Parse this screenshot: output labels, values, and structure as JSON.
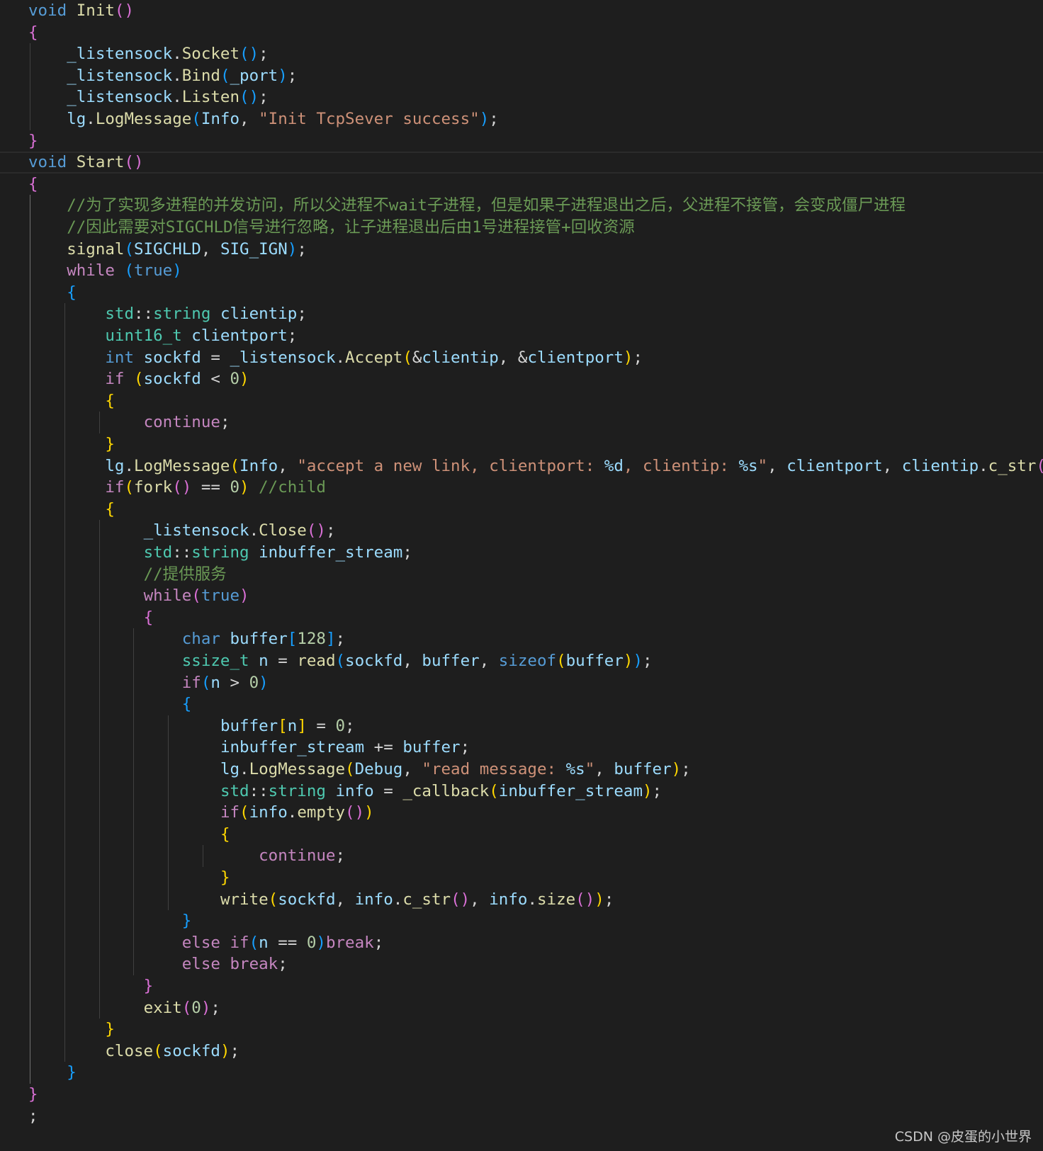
{
  "editor": {
    "lines": [
      [
        [
          "kw",
          "void"
        ],
        [
          "plain",
          " "
        ],
        [
          "fn",
          "Init"
        ],
        [
          "b2",
          "()"
        ]
      ],
      [
        [
          "b2",
          "{"
        ]
      ],
      [
        [
          "plain",
          "    "
        ],
        [
          "var",
          "_listensock"
        ],
        [
          "plain",
          "."
        ],
        [
          "fn",
          "Socket"
        ],
        [
          "b3",
          "()"
        ],
        [
          "plain",
          ";"
        ]
      ],
      [
        [
          "plain",
          "    "
        ],
        [
          "var",
          "_listensock"
        ],
        [
          "plain",
          "."
        ],
        [
          "fn",
          "Bind"
        ],
        [
          "b3",
          "("
        ],
        [
          "var",
          "_port"
        ],
        [
          "b3",
          ")"
        ],
        [
          "plain",
          ";"
        ]
      ],
      [
        [
          "plain",
          "    "
        ],
        [
          "var",
          "_listensock"
        ],
        [
          "plain",
          "."
        ],
        [
          "fn",
          "Listen"
        ],
        [
          "b3",
          "()"
        ],
        [
          "plain",
          ";"
        ]
      ],
      [
        [
          "plain",
          "    "
        ],
        [
          "var",
          "lg"
        ],
        [
          "plain",
          "."
        ],
        [
          "fn",
          "LogMessage"
        ],
        [
          "b3",
          "("
        ],
        [
          "var",
          "Info"
        ],
        [
          "plain",
          ", "
        ],
        [
          "str",
          "\"Init TcpSever success\""
        ],
        [
          "b3",
          ")"
        ],
        [
          "plain",
          ";"
        ]
      ],
      [
        [
          "b2",
          "}"
        ]
      ],
      [
        [
          "kw",
          "void"
        ],
        [
          "plain",
          " "
        ],
        [
          "fn",
          "Start"
        ],
        [
          "b2",
          "()"
        ]
      ],
      [
        [
          "b2",
          "{"
        ]
      ],
      [
        [
          "plain",
          "    "
        ],
        [
          "cmt",
          "//为了实现多进程的并发访问，所以父进程不wait子进程，但是如果子进程退出之后，父进程不接管，会变成僵尸进程"
        ]
      ],
      [
        [
          "plain",
          "    "
        ],
        [
          "cmt",
          "//因此需要对SIGCHLD信号进行忽略，让子进程退出后由1号进程接管+回收资源"
        ]
      ],
      [
        [
          "plain",
          "    "
        ],
        [
          "fn",
          "signal"
        ],
        [
          "b3",
          "("
        ],
        [
          "var",
          "SIGCHLD"
        ],
        [
          "plain",
          ", "
        ],
        [
          "var",
          "SIG_IGN"
        ],
        [
          "b3",
          ")"
        ],
        [
          "plain",
          ";"
        ]
      ],
      [
        [
          "plain",
          "    "
        ],
        [
          "kw-ctrl",
          "while"
        ],
        [
          "plain",
          " "
        ],
        [
          "b3",
          "("
        ],
        [
          "kw",
          "true"
        ],
        [
          "b3",
          ")"
        ]
      ],
      [
        [
          "plain",
          "    "
        ],
        [
          "b3",
          "{"
        ]
      ],
      [
        [
          "plain",
          "        "
        ],
        [
          "type",
          "std"
        ],
        [
          "plain",
          "::"
        ],
        [
          "type",
          "string"
        ],
        [
          "plain",
          " "
        ],
        [
          "var",
          "clientip"
        ],
        [
          "plain",
          ";"
        ]
      ],
      [
        [
          "plain",
          "        "
        ],
        [
          "type",
          "uint16_t"
        ],
        [
          "plain",
          " "
        ],
        [
          "var",
          "clientport"
        ],
        [
          "plain",
          ";"
        ]
      ],
      [
        [
          "plain",
          "        "
        ],
        [
          "kw",
          "int"
        ],
        [
          "plain",
          " "
        ],
        [
          "var",
          "sockfd"
        ],
        [
          "plain",
          " = "
        ],
        [
          "var",
          "_listensock"
        ],
        [
          "plain",
          "."
        ],
        [
          "fn",
          "Accept"
        ],
        [
          "b1",
          "("
        ],
        [
          "plain",
          "&"
        ],
        [
          "var",
          "clientip"
        ],
        [
          "plain",
          ", &"
        ],
        [
          "var",
          "clientport"
        ],
        [
          "b1",
          ")"
        ],
        [
          "plain",
          ";"
        ]
      ],
      [
        [
          "plain",
          "        "
        ],
        [
          "kw-ctrl",
          "if"
        ],
        [
          "plain",
          " "
        ],
        [
          "b1",
          "("
        ],
        [
          "var",
          "sockfd"
        ],
        [
          "plain",
          " < "
        ],
        [
          "num",
          "0"
        ],
        [
          "b1",
          ")"
        ]
      ],
      [
        [
          "plain",
          "        "
        ],
        [
          "b1",
          "{"
        ]
      ],
      [
        [
          "plain",
          "            "
        ],
        [
          "kw-ctrl",
          "continue"
        ],
        [
          "plain",
          ";"
        ]
      ],
      [
        [
          "plain",
          "        "
        ],
        [
          "b1",
          "}"
        ]
      ],
      [
        [
          "plain",
          "        "
        ],
        [
          "var",
          "lg"
        ],
        [
          "plain",
          "."
        ],
        [
          "fn",
          "LogMessage"
        ],
        [
          "b1",
          "("
        ],
        [
          "var",
          "Info"
        ],
        [
          "plain",
          ", "
        ],
        [
          "str",
          "\"accept a new link, clientport: "
        ],
        [
          "fmt",
          "%d"
        ],
        [
          "str",
          ", clientip: "
        ],
        [
          "fmt",
          "%s"
        ],
        [
          "str",
          "\""
        ],
        [
          "plain",
          ", "
        ],
        [
          "var",
          "clientport"
        ],
        [
          "plain",
          ", "
        ],
        [
          "var",
          "clientip"
        ],
        [
          "plain",
          "."
        ],
        [
          "fn",
          "c_str"
        ],
        [
          "b2",
          "()"
        ],
        [
          "b1",
          ")"
        ],
        [
          "plain",
          ";"
        ]
      ],
      [
        [
          "plain",
          "        "
        ],
        [
          "kw-ctrl",
          "if"
        ],
        [
          "b1",
          "("
        ],
        [
          "fn",
          "fork"
        ],
        [
          "b2",
          "()"
        ],
        [
          "plain",
          " == "
        ],
        [
          "num",
          "0"
        ],
        [
          "b1",
          ")"
        ],
        [
          "plain",
          " "
        ],
        [
          "cmt",
          "//child"
        ]
      ],
      [
        [
          "plain",
          "        "
        ],
        [
          "b1",
          "{"
        ]
      ],
      [
        [
          "plain",
          "            "
        ],
        [
          "var",
          "_listensock"
        ],
        [
          "plain",
          "."
        ],
        [
          "fn",
          "Close"
        ],
        [
          "b2",
          "()"
        ],
        [
          "plain",
          ";"
        ]
      ],
      [
        [
          "plain",
          "            "
        ],
        [
          "type",
          "std"
        ],
        [
          "plain",
          "::"
        ],
        [
          "type",
          "string"
        ],
        [
          "plain",
          " "
        ],
        [
          "var",
          "inbuffer_stream"
        ],
        [
          "plain",
          ";"
        ]
      ],
      [
        [
          "plain",
          "            "
        ],
        [
          "cmt",
          "//提供服务"
        ]
      ],
      [
        [
          "plain",
          "            "
        ],
        [
          "kw-ctrl",
          "while"
        ],
        [
          "b2",
          "("
        ],
        [
          "kw",
          "true"
        ],
        [
          "b2",
          ")"
        ]
      ],
      [
        [
          "plain",
          "            "
        ],
        [
          "b2",
          "{"
        ]
      ],
      [
        [
          "plain",
          "                "
        ],
        [
          "kw",
          "char"
        ],
        [
          "plain",
          " "
        ],
        [
          "var",
          "buffer"
        ],
        [
          "b3",
          "["
        ],
        [
          "num",
          "128"
        ],
        [
          "b3",
          "]"
        ],
        [
          "plain",
          ";"
        ]
      ],
      [
        [
          "plain",
          "                "
        ],
        [
          "type",
          "ssize_t"
        ],
        [
          "plain",
          " "
        ],
        [
          "var",
          "n"
        ],
        [
          "plain",
          " = "
        ],
        [
          "fn",
          "read"
        ],
        [
          "b3",
          "("
        ],
        [
          "var",
          "sockfd"
        ],
        [
          "plain",
          ", "
        ],
        [
          "var",
          "buffer"
        ],
        [
          "plain",
          ", "
        ],
        [
          "kw",
          "sizeof"
        ],
        [
          "b1",
          "("
        ],
        [
          "var",
          "buffer"
        ],
        [
          "b1",
          ")"
        ],
        [
          "b3",
          ")"
        ],
        [
          "plain",
          ";"
        ]
      ],
      [
        [
          "plain",
          "                "
        ],
        [
          "kw-ctrl",
          "if"
        ],
        [
          "b3",
          "("
        ],
        [
          "var",
          "n"
        ],
        [
          "plain",
          " > "
        ],
        [
          "num",
          "0"
        ],
        [
          "b3",
          ")"
        ]
      ],
      [
        [
          "plain",
          "                "
        ],
        [
          "b3",
          "{"
        ]
      ],
      [
        [
          "plain",
          "                    "
        ],
        [
          "var",
          "buffer"
        ],
        [
          "b1",
          "["
        ],
        [
          "var",
          "n"
        ],
        [
          "b1",
          "]"
        ],
        [
          "plain",
          " = "
        ],
        [
          "num",
          "0"
        ],
        [
          "plain",
          ";"
        ]
      ],
      [
        [
          "plain",
          "                    "
        ],
        [
          "var",
          "inbuffer_stream"
        ],
        [
          "plain",
          " += "
        ],
        [
          "var",
          "buffer"
        ],
        [
          "plain",
          ";"
        ]
      ],
      [
        [
          "plain",
          "                    "
        ],
        [
          "var",
          "lg"
        ],
        [
          "plain",
          "."
        ],
        [
          "fn",
          "LogMessage"
        ],
        [
          "b1",
          "("
        ],
        [
          "var",
          "Debug"
        ],
        [
          "plain",
          ", "
        ],
        [
          "str",
          "\"read message: "
        ],
        [
          "fmt",
          "%s"
        ],
        [
          "str",
          "\""
        ],
        [
          "plain",
          ", "
        ],
        [
          "var",
          "buffer"
        ],
        [
          "b1",
          ")"
        ],
        [
          "plain",
          ";"
        ]
      ],
      [
        [
          "plain",
          "                    "
        ],
        [
          "type",
          "std"
        ],
        [
          "plain",
          "::"
        ],
        [
          "type",
          "string"
        ],
        [
          "plain",
          " "
        ],
        [
          "var",
          "info"
        ],
        [
          "plain",
          " = "
        ],
        [
          "fn",
          "_callback"
        ],
        [
          "b1",
          "("
        ],
        [
          "var",
          "inbuffer_stream"
        ],
        [
          "b1",
          ")"
        ],
        [
          "plain",
          ";"
        ]
      ],
      [
        [
          "plain",
          "                    "
        ],
        [
          "kw-ctrl",
          "if"
        ],
        [
          "b1",
          "("
        ],
        [
          "var",
          "info"
        ],
        [
          "plain",
          "."
        ],
        [
          "fn",
          "empty"
        ],
        [
          "b2",
          "()"
        ],
        [
          "b1",
          ")"
        ]
      ],
      [
        [
          "plain",
          "                    "
        ],
        [
          "b1",
          "{"
        ]
      ],
      [
        [
          "plain",
          "                        "
        ],
        [
          "kw-ctrl",
          "continue"
        ],
        [
          "plain",
          ";"
        ]
      ],
      [
        [
          "plain",
          "                    "
        ],
        [
          "b1",
          "}"
        ]
      ],
      [
        [
          "plain",
          "                    "
        ],
        [
          "fn",
          "write"
        ],
        [
          "b1",
          "("
        ],
        [
          "var",
          "sockfd"
        ],
        [
          "plain",
          ", "
        ],
        [
          "var",
          "info"
        ],
        [
          "plain",
          "."
        ],
        [
          "fn",
          "c_str"
        ],
        [
          "b2",
          "()"
        ],
        [
          "plain",
          ", "
        ],
        [
          "var",
          "info"
        ],
        [
          "plain",
          "."
        ],
        [
          "fn",
          "size"
        ],
        [
          "b2",
          "()"
        ],
        [
          "b1",
          ")"
        ],
        [
          "plain",
          ";"
        ]
      ],
      [
        [
          "plain",
          "                "
        ],
        [
          "b3",
          "}"
        ]
      ],
      [
        [
          "plain",
          "                "
        ],
        [
          "kw-ctrl",
          "else"
        ],
        [
          "plain",
          " "
        ],
        [
          "kw-ctrl",
          "if"
        ],
        [
          "b3",
          "("
        ],
        [
          "var",
          "n"
        ],
        [
          "plain",
          " == "
        ],
        [
          "num",
          "0"
        ],
        [
          "b3",
          ")"
        ],
        [
          "kw-ctrl",
          "break"
        ],
        [
          "plain",
          ";"
        ]
      ],
      [
        [
          "plain",
          "                "
        ],
        [
          "kw-ctrl",
          "else"
        ],
        [
          "plain",
          " "
        ],
        [
          "kw-ctrl",
          "break"
        ],
        [
          "plain",
          ";"
        ]
      ],
      [
        [
          "plain",
          "            "
        ],
        [
          "b2",
          "}"
        ]
      ],
      [
        [
          "plain",
          "            "
        ],
        [
          "fn",
          "exit"
        ],
        [
          "b2",
          "("
        ],
        [
          "num",
          "0"
        ],
        [
          "b2",
          ")"
        ],
        [
          "plain",
          ";"
        ]
      ],
      [
        [
          "plain",
          "        "
        ],
        [
          "b1",
          "}"
        ]
      ],
      [
        [
          "plain",
          "        "
        ],
        [
          "fn",
          "close"
        ],
        [
          "b1",
          "("
        ],
        [
          "var",
          "sockfd"
        ],
        [
          "b1",
          ")"
        ],
        [
          "plain",
          ";"
        ]
      ],
      [
        [
          "plain",
          "    "
        ],
        [
          "b3",
          "}"
        ]
      ],
      [
        [
          "b2",
          "}"
        ]
      ],
      [
        [
          "plain",
          ";"
        ]
      ]
    ]
  },
  "watermark": "CSDN @皮蛋的小世界"
}
